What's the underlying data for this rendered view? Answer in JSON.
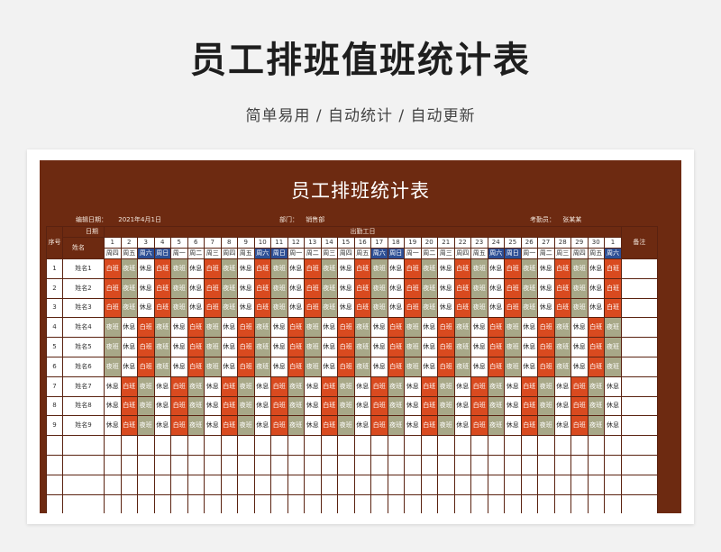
{
  "promo": {
    "title": "员工排班值班统计表",
    "subtitle": "简单易用  /  自动统计  /  自动更新"
  },
  "sheet": {
    "title": "员工排班统计表",
    "edit_date_label": "编辑日期：",
    "edit_date": "2021年4月1日",
    "dept_label": "部门：",
    "dept": "销售部",
    "checker_label": "考勤员：",
    "checker": "张某某",
    "col_seq": "序号",
    "col_date": "日期",
    "col_name": "姓名",
    "col_attendance": "出勤工日",
    "col_remark": "备注",
    "days": [
      "1",
      "2",
      "3",
      "4",
      "5",
      "6",
      "7",
      "8",
      "9",
      "10",
      "11",
      "12",
      "13",
      "14",
      "15",
      "16",
      "17",
      "18",
      "19",
      "20",
      "21",
      "22",
      "23",
      "24",
      "25",
      "26",
      "27",
      "28",
      "29",
      "30",
      "1"
    ],
    "weekdays": [
      "周四",
      "周五",
      "周六",
      "周日",
      "周一",
      "周二",
      "周三",
      "周四",
      "周五",
      "周六",
      "周日",
      "周一",
      "周二",
      "周三",
      "周四",
      "周五",
      "周六",
      "周日",
      "周一",
      "周二",
      "周三",
      "周四",
      "周五",
      "周六",
      "周日",
      "周一",
      "周二",
      "周三",
      "周四",
      "周五",
      "周六"
    ],
    "weekend_indices": [
      2,
      3,
      9,
      10,
      16,
      17,
      23,
      24,
      30
    ],
    "shift_labels": {
      "D": "白班",
      "N": "夜班",
      "R": "休息"
    },
    "shift_colors": {
      "D": "#d94a1f",
      "N": "#a8a888",
      "R": "#ffffff",
      "weekend_header": "#2d4f95",
      "sheet_bg": "#6d2a11"
    },
    "employees": [
      {
        "seq": "1",
        "name": "姓名1",
        "pattern": "DNR"
      },
      {
        "seq": "2",
        "name": "姓名2",
        "pattern": "DNR"
      },
      {
        "seq": "3",
        "name": "姓名3",
        "pattern": "DNR"
      },
      {
        "seq": "4",
        "name": "姓名4",
        "pattern": "NRD"
      },
      {
        "seq": "5",
        "name": "姓名5",
        "pattern": "NRD"
      },
      {
        "seq": "6",
        "name": "姓名6",
        "pattern": "NRD"
      },
      {
        "seq": "7",
        "name": "姓名7",
        "pattern": "RDN"
      },
      {
        "seq": "8",
        "name": "姓名8",
        "pattern": "RDN"
      },
      {
        "seq": "9",
        "name": "姓名9",
        "pattern": "RDN"
      }
    ],
    "blank_rows": 5
  }
}
